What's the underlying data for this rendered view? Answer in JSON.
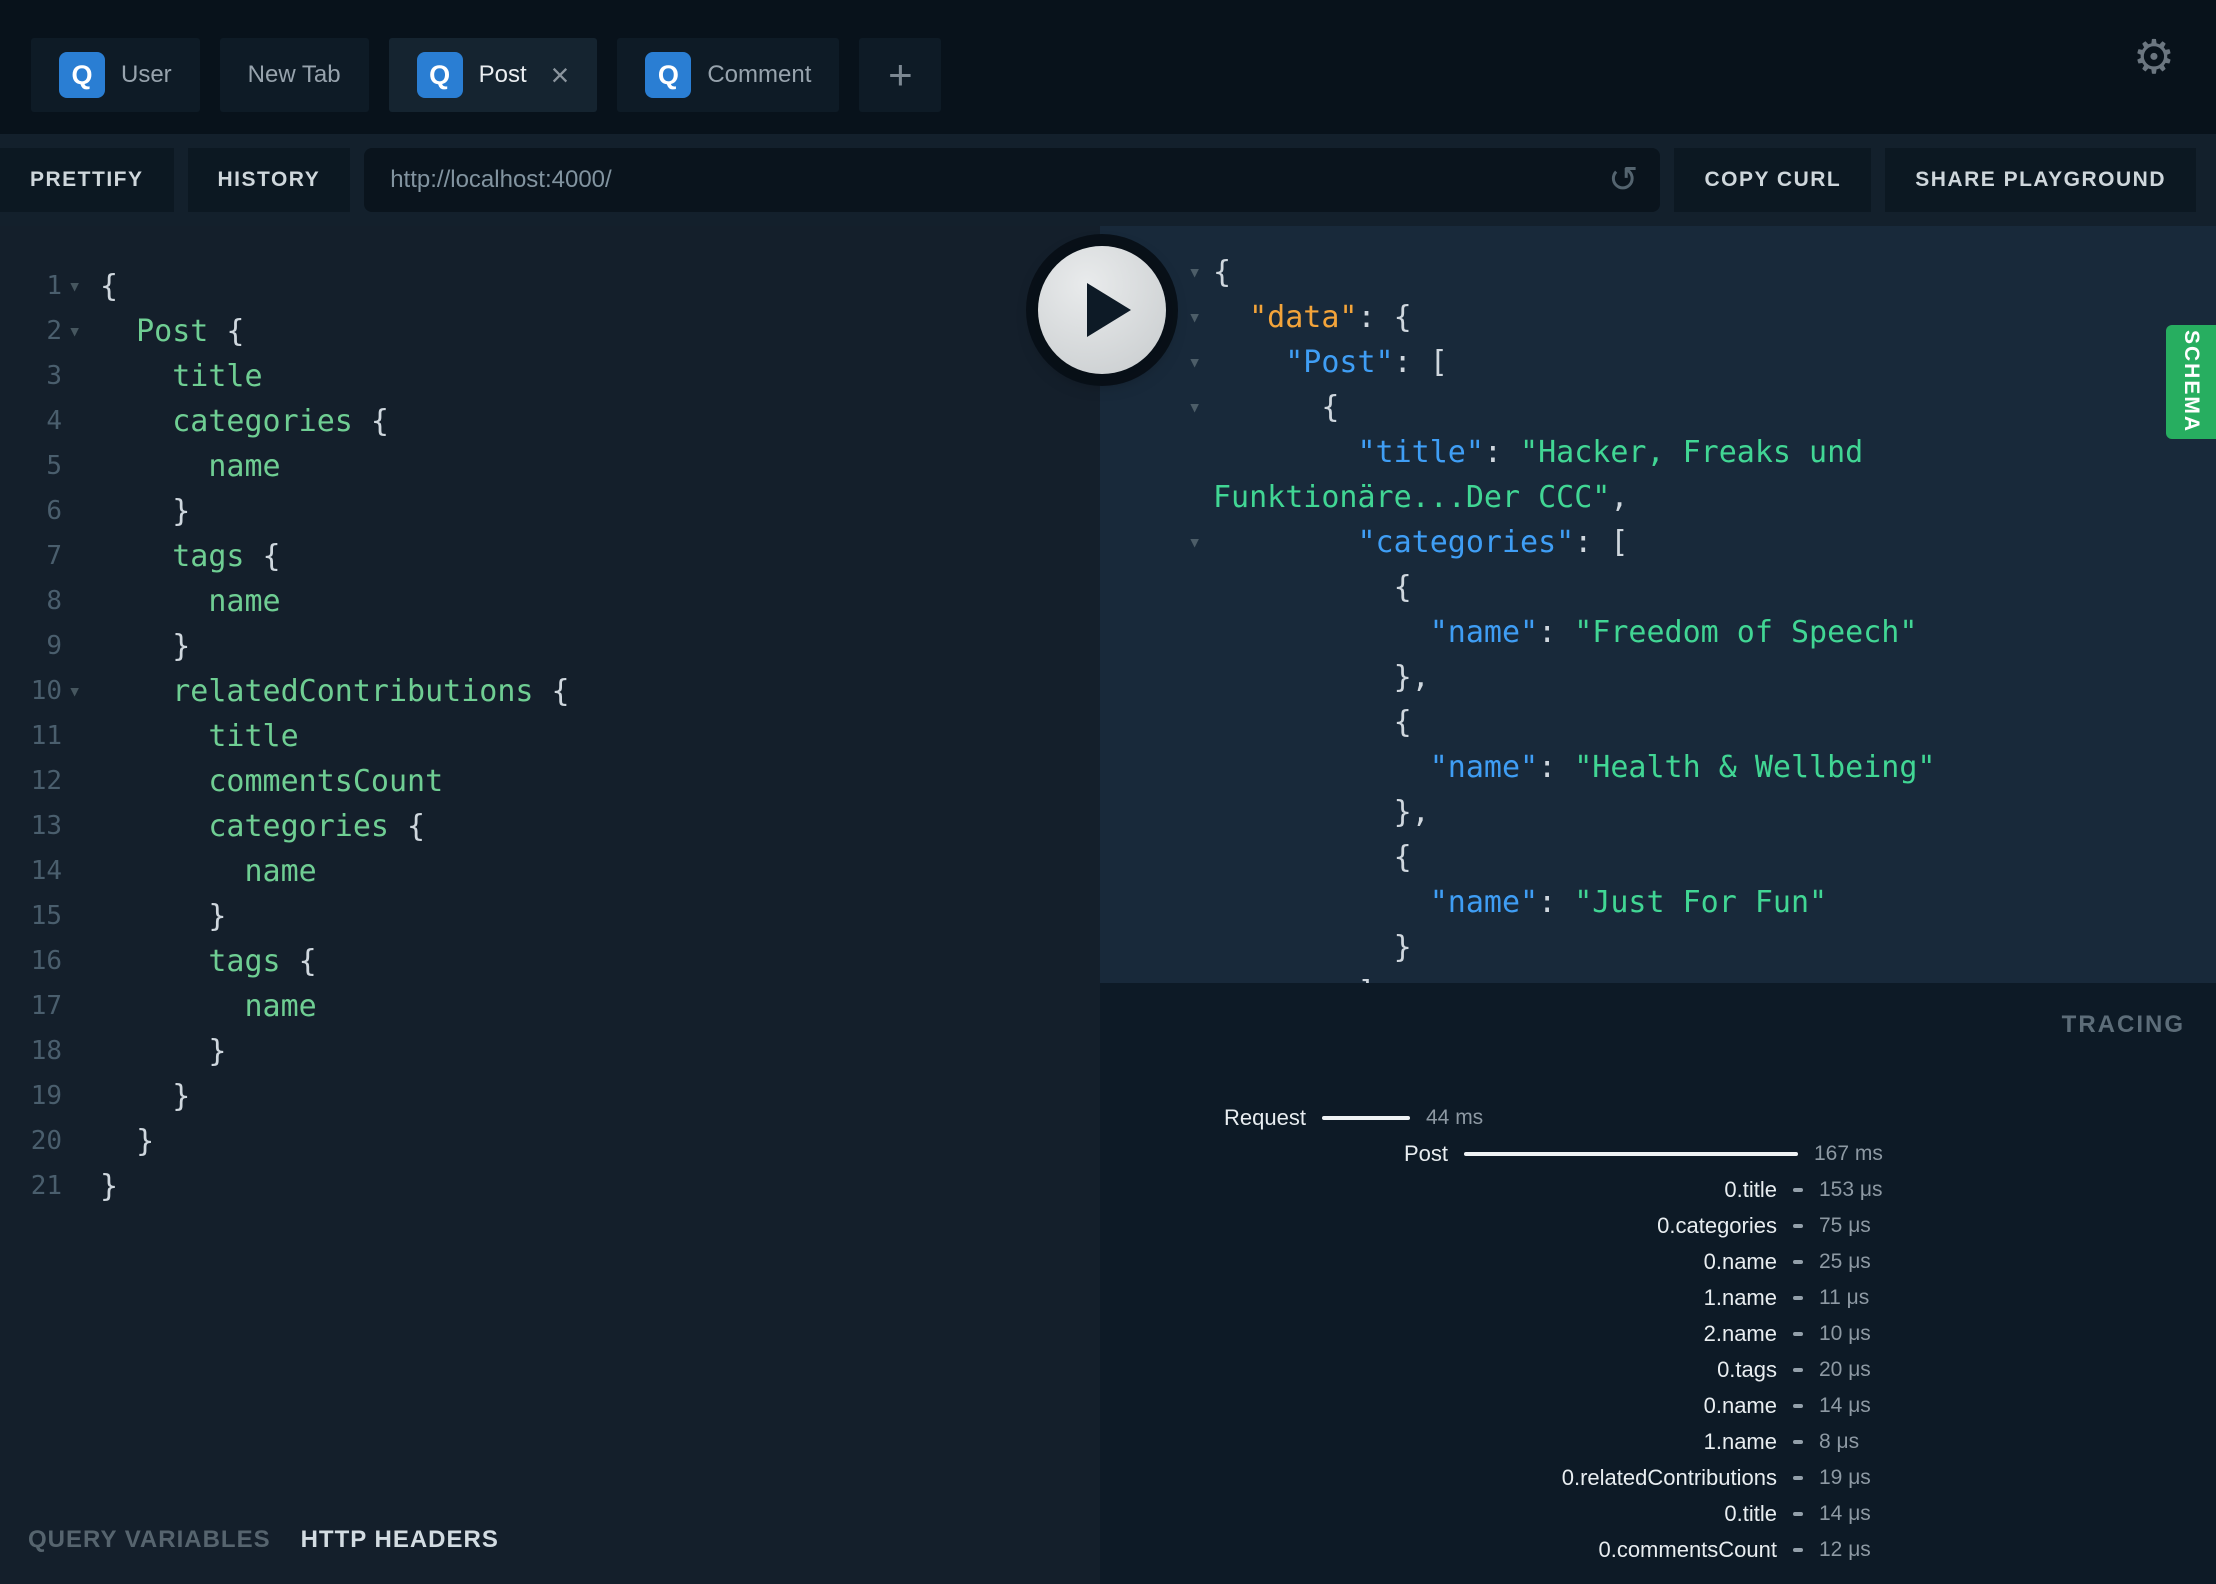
{
  "colors": {
    "accent_blue": "#2a7ed3",
    "schema_green": "#27ae60",
    "field_green": "#6fce93",
    "string_green": "#41d694",
    "key_blue": "#3f9ef5",
    "data_key_orange": "#f3a43a",
    "background_dark": "#08121b",
    "response_background": "#18293a"
  },
  "icons": {
    "settings_glyph": "⚙",
    "reload_glyph": "↺",
    "close_glyph": "×",
    "fold_glyph": "▾",
    "plus_glyph": "+",
    "tab_logo_letter": "Q",
    "play_icon": "play-triangle"
  },
  "tabs": {
    "items": [
      {
        "label": "User"
      },
      {
        "label": "New Tab"
      },
      {
        "label": "Post"
      },
      {
        "label": "Comment"
      }
    ]
  },
  "toolbar": {
    "prettify": "PRETTIFY",
    "history": "HISTORY",
    "url": "http://localhost:4000/",
    "copy_curl": "COPY CURL",
    "share": "SHARE PLAYGROUND"
  },
  "editor": {
    "lines": [
      {
        "num": 1,
        "fold": true,
        "indent": 0,
        "tokens": [
          {
            "t": "punct",
            "v": "{"
          }
        ]
      },
      {
        "num": 2,
        "fold": true,
        "indent": 1,
        "tokens": [
          {
            "t": "field",
            "v": "Post"
          },
          {
            "t": "punct",
            "v": " {"
          }
        ]
      },
      {
        "num": 3,
        "indent": 2,
        "tokens": [
          {
            "t": "field",
            "v": "title"
          }
        ]
      },
      {
        "num": 4,
        "indent": 2,
        "tokens": [
          {
            "t": "field",
            "v": "categories"
          },
          {
            "t": "punct",
            "v": " {"
          }
        ]
      },
      {
        "num": 5,
        "indent": 3,
        "tokens": [
          {
            "t": "field",
            "v": "name"
          }
        ]
      },
      {
        "num": 6,
        "indent": 2,
        "tokens": [
          {
            "t": "punct",
            "v": "}"
          }
        ]
      },
      {
        "num": 7,
        "indent": 2,
        "tokens": [
          {
            "t": "field",
            "v": "tags"
          },
          {
            "t": "punct",
            "v": " {"
          }
        ]
      },
      {
        "num": 8,
        "indent": 3,
        "tokens": [
          {
            "t": "field",
            "v": "name"
          }
        ]
      },
      {
        "num": 9,
        "indent": 2,
        "tokens": [
          {
            "t": "punct",
            "v": "}"
          }
        ]
      },
      {
        "num": 10,
        "fold": true,
        "indent": 2,
        "tokens": [
          {
            "t": "field",
            "v": "relatedContributions"
          },
          {
            "t": "punct",
            "v": " {"
          }
        ]
      },
      {
        "num": 11,
        "indent": 3,
        "tokens": [
          {
            "t": "field",
            "v": "title"
          }
        ]
      },
      {
        "num": 12,
        "indent": 3,
        "tokens": [
          {
            "t": "field",
            "v": "commentsCount"
          }
        ]
      },
      {
        "num": 13,
        "indent": 3,
        "tokens": [
          {
            "t": "field",
            "v": "categories"
          },
          {
            "t": "punct",
            "v": " {"
          }
        ]
      },
      {
        "num": 14,
        "indent": 4,
        "tokens": [
          {
            "t": "field",
            "v": "name"
          }
        ]
      },
      {
        "num": 15,
        "indent": 3,
        "tokens": [
          {
            "t": "punct",
            "v": "}"
          }
        ]
      },
      {
        "num": 16,
        "indent": 3,
        "tokens": [
          {
            "t": "field",
            "v": "tags"
          },
          {
            "t": "punct",
            "v": " {"
          }
        ]
      },
      {
        "num": 17,
        "indent": 4,
        "tokens": [
          {
            "t": "field",
            "v": "name"
          }
        ]
      },
      {
        "num": 18,
        "indent": 3,
        "tokens": [
          {
            "t": "punct",
            "v": "}"
          }
        ]
      },
      {
        "num": 19,
        "indent": 2,
        "tokens": [
          {
            "t": "punct",
            "v": "}"
          }
        ]
      },
      {
        "num": 20,
        "indent": 1,
        "tokens": [
          {
            "t": "punct",
            "v": "}"
          }
        ]
      },
      {
        "num": 21,
        "indent": 0,
        "tokens": [
          {
            "t": "punct",
            "v": "}"
          }
        ]
      }
    ]
  },
  "response": {
    "lines": [
      {
        "fold": true,
        "indent": 0,
        "tokens": [
          {
            "t": "punct",
            "v": "{"
          }
        ]
      },
      {
        "fold": true,
        "indent": 1,
        "tokens": [
          {
            "t": "keyd",
            "v": "\"data\""
          },
          {
            "t": "punct",
            "v": ": {"
          }
        ]
      },
      {
        "fold": true,
        "indent": 2,
        "tokens": [
          {
            "t": "key",
            "v": "\"Post\""
          },
          {
            "t": "punct",
            "v": ": ["
          }
        ]
      },
      {
        "fold": true,
        "indent": 3,
        "tokens": [
          {
            "t": "punct",
            "v": "{"
          }
        ]
      },
      {
        "indent": 4,
        "tokens": [
          {
            "t": "key",
            "v": "\"title\""
          },
          {
            "t": "punct",
            "v": ": "
          },
          {
            "t": "str",
            "v": "\"Hacker, Freaks und"
          }
        ]
      },
      {
        "indent": 0,
        "tokens": [
          {
            "t": "str",
            "v": "Funktionäre...Der CCC\""
          },
          {
            "t": "punct",
            "v": ","
          }
        ]
      },
      {
        "fold": true,
        "indent": 4,
        "tokens": [
          {
            "t": "key",
            "v": "\"categories\""
          },
          {
            "t": "punct",
            "v": ": ["
          }
        ]
      },
      {
        "indent": 5,
        "tokens": [
          {
            "t": "punct",
            "v": "{"
          }
        ]
      },
      {
        "indent": 6,
        "tokens": [
          {
            "t": "key",
            "v": "\"name\""
          },
          {
            "t": "punct",
            "v": ": "
          },
          {
            "t": "str",
            "v": "\"Freedom of Speech\""
          }
        ]
      },
      {
        "indent": 5,
        "tokens": [
          {
            "t": "punct",
            "v": "},"
          }
        ]
      },
      {
        "indent": 5,
        "tokens": [
          {
            "t": "punct",
            "v": "{"
          }
        ]
      },
      {
        "indent": 6,
        "tokens": [
          {
            "t": "key",
            "v": "\"name\""
          },
          {
            "t": "punct",
            "v": ": "
          },
          {
            "t": "str",
            "v": "\"Health & Wellbeing\""
          }
        ]
      },
      {
        "indent": 5,
        "tokens": [
          {
            "t": "punct",
            "v": "},"
          }
        ]
      },
      {
        "indent": 5,
        "tokens": [
          {
            "t": "punct",
            "v": "{"
          }
        ]
      },
      {
        "indent": 6,
        "tokens": [
          {
            "t": "key",
            "v": "\"name\""
          },
          {
            "t": "punct",
            "v": ": "
          },
          {
            "t": "str",
            "v": "\"Just For Fun\""
          }
        ]
      },
      {
        "indent": 5,
        "tokens": [
          {
            "t": "punct",
            "v": "}"
          }
        ]
      },
      {
        "indent": 4,
        "tokens": [
          {
            "t": "punct",
            "v": "]"
          }
        ]
      }
    ]
  },
  "schema_tab_label": "SCHEMA",
  "tracing": {
    "title": "TRACING",
    "rows": [
      {
        "label": "Request",
        "ms": 44,
        "display": "44 ms",
        "depth": 0
      },
      {
        "label": "Post",
        "ms": 167,
        "display": "167 ms",
        "depth": 1
      },
      {
        "label": "0.title",
        "us": 153,
        "display": "153 μs",
        "depth": 2
      },
      {
        "label": "0.categories",
        "us": 75,
        "display": "75 μs",
        "depth": 2
      },
      {
        "label": "0.name",
        "us": 25,
        "display": "25 μs",
        "depth": 2
      },
      {
        "label": "1.name",
        "us": 11,
        "display": "11 μs",
        "depth": 2
      },
      {
        "label": "2.name",
        "us": 10,
        "display": "10 μs",
        "depth": 2
      },
      {
        "label": "0.tags",
        "us": 20,
        "display": "20 μs",
        "depth": 2
      },
      {
        "label": "0.name",
        "us": 14,
        "display": "14 μs",
        "depth": 2
      },
      {
        "label": "1.name",
        "us": 8,
        "display": "8 μs",
        "depth": 2
      },
      {
        "label": "0.relatedContributions",
        "us": 19,
        "display": "19 μs",
        "depth": 2
      },
      {
        "label": "0.title",
        "us": 14,
        "display": "14 μs",
        "depth": 2
      },
      {
        "label": "0.commentsCount",
        "us": 12,
        "display": "12 μs",
        "depth": 2
      }
    ]
  },
  "bottom_bar": {
    "query_variables": "QUERY VARIABLES",
    "http_headers": "HTTP HEADERS"
  }
}
